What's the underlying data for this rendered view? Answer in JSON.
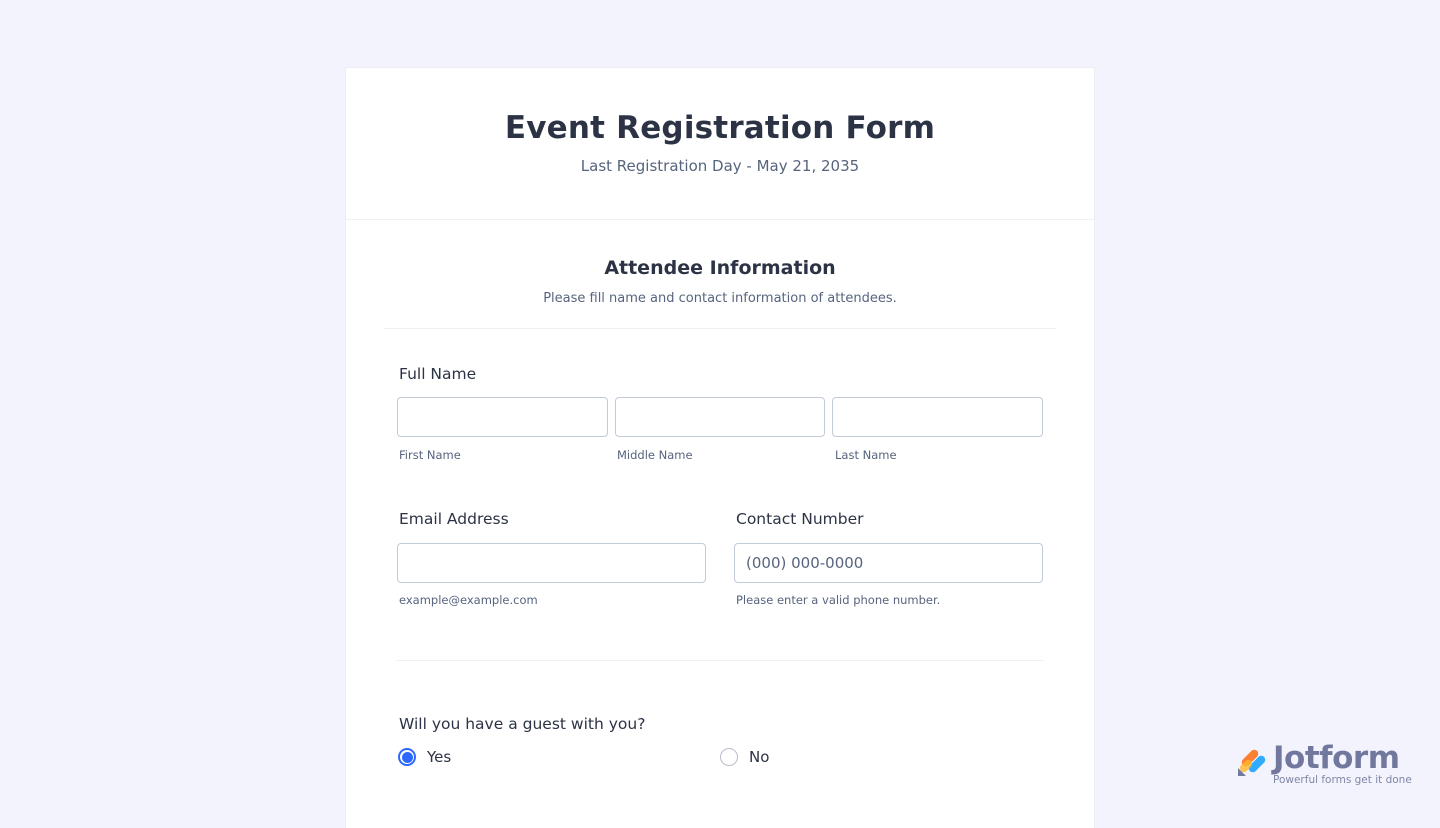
{
  "form": {
    "title": "Event Registration Form",
    "subtitle": "Last Registration Day - May 21, 2035"
  },
  "section": {
    "title": "Attendee Information",
    "description": "Please fill name and contact information of attendees."
  },
  "full_name": {
    "label": "Full Name",
    "first": {
      "value": "",
      "sublabel": "First Name"
    },
    "middle": {
      "value": "",
      "sublabel": "Middle Name"
    },
    "last": {
      "value": "",
      "sublabel": "Last Name"
    }
  },
  "email": {
    "label": "Email Address",
    "value": "",
    "sublabel": "example@example.com"
  },
  "contact": {
    "label": "Contact Number",
    "placeholder": "(000) 000-0000",
    "sublabel": "Please enter a valid phone number."
  },
  "guest": {
    "question": "Will you have a guest with you?",
    "options": [
      {
        "label": "Yes",
        "selected": true
      },
      {
        "label": "No",
        "selected": false
      }
    ]
  },
  "branding": {
    "name": "Jotform",
    "tagline": "Powerful forms get it done"
  },
  "colors": {
    "page_background": "#f2f3fc",
    "accent": "#2e69ff",
    "text": "#2c3345",
    "muted_text": "#57647e"
  }
}
